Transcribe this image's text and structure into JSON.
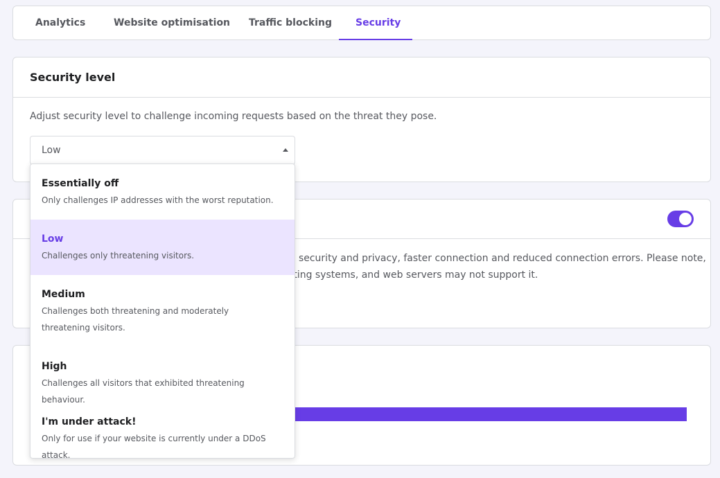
{
  "tabs": [
    {
      "label": "Analytics"
    },
    {
      "label": "Website optimisation"
    },
    {
      "label": "Traffic blocking"
    },
    {
      "label": "Security"
    }
  ],
  "active_tab": "Security",
  "security_level": {
    "title": "Security level",
    "description": "Adjust security level to challenge incoming requests based on the threat they pose.",
    "selected": "Low",
    "options": [
      {
        "title": "Essentially off",
        "description": "Only challenges IP addresses with the worst reputation."
      },
      {
        "title": "Low",
        "description": "Challenges only threatening visitors."
      },
      {
        "title": "Medium",
        "description": "Challenges both threatening and moderately threatening visitors."
      },
      {
        "title": "High",
        "description": "Challenges all visitors that exhibited threatening behaviour."
      },
      {
        "title": "I'm under attack!",
        "description": "Only for use if your website is currently under a DDoS attack."
      }
    ]
  },
  "second_card": {
    "toggle_on": true,
    "text_line1": "ed security and privacy, faster connection and reduced connection errors. Please note,",
    "text_line2": "rating systems, and web servers may not support it."
  },
  "colors": {
    "accent": "#673de6",
    "selected_bg": "#ebe4ff",
    "text": "#1d1e20",
    "muted": "#56585e"
  }
}
